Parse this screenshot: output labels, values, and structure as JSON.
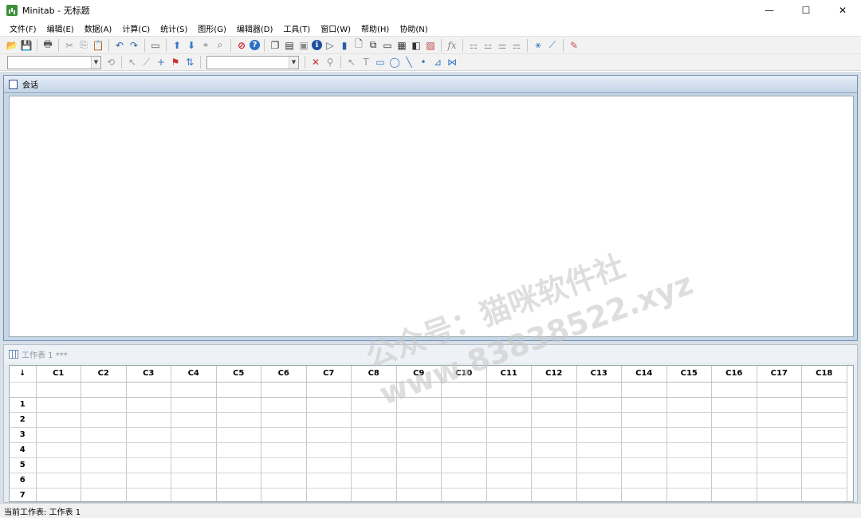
{
  "window": {
    "title": "Minitab - 无标题",
    "min_glyph": "—",
    "max_glyph": "☐",
    "close_glyph": "✕"
  },
  "menu": [
    "文件(F)",
    "编辑(E)",
    "数据(A)",
    "计算(C)",
    "统计(S)",
    "图形(G)",
    "编辑器(D)",
    "工具(T)",
    "窗口(W)",
    "帮助(H)",
    "协助(N)"
  ],
  "session": {
    "title": "会话"
  },
  "worksheet": {
    "title": "工作表 1 ***",
    "corner_glyph": "↓",
    "columns": [
      "C1",
      "C2",
      "C3",
      "C4",
      "C5",
      "C6",
      "C7",
      "C8",
      "C9",
      "C10",
      "C11",
      "C12",
      "C13",
      "C14",
      "C15",
      "C16",
      "C17",
      "C18"
    ],
    "rows": [
      "1",
      "2",
      "3",
      "4",
      "5",
      "6",
      "7"
    ]
  },
  "status": {
    "text": "当前工作表: 工作表 1"
  },
  "watermark": {
    "line1": "公众号：猫咪软件社",
    "line2": "www.83838522.xyz"
  },
  "toolbar_icons": {
    "open": "📂",
    "save": "💾",
    "print": "🖶",
    "cut": "✂",
    "copy": "⎘",
    "paste": "📋",
    "undo": "↶",
    "redo": "↷",
    "window": "▭",
    "up": "⬆",
    "down": "⬇",
    "find": "⌖",
    "replace": "⌕",
    "cancel": "⊘",
    "help": "?",
    "info": "ℹ",
    "fx": "fx",
    "brush": "✎",
    "pointer": "↖",
    "text": "T",
    "rect": "▭",
    "ellipse": "◯",
    "line": "╲",
    "dot": "•",
    "delete": "✕",
    "zoom": "⚲"
  }
}
